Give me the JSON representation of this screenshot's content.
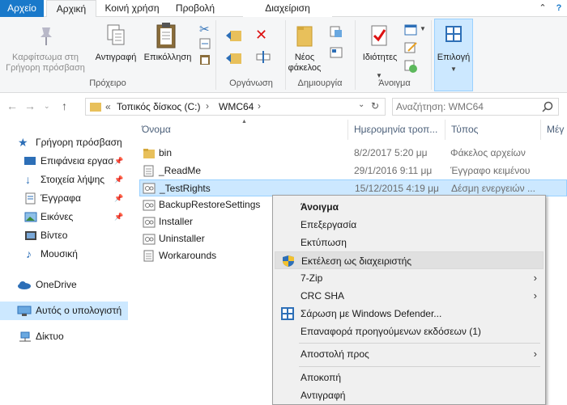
{
  "tabs": {
    "file": "Αρχείο",
    "home": "Αρχική",
    "share": "Κοινή χρήση",
    "view": "Προβολή",
    "manage": "Διαχείριση"
  },
  "ribbon": {
    "pin_quick_access": "Καρφίτσωμα στη Γρήγορη πρόσβαση",
    "copy": "Αντιγραφή",
    "paste": "Επικόλληση",
    "clipboard_group": "Πρόχειρο",
    "organize_group": "Οργάνωση",
    "new_folder": "Νέος φάκελος",
    "create_group": "Δημιουργία",
    "properties": "Ιδιότητες",
    "open_group": "Άνοιγμα",
    "select": "Επιλογή"
  },
  "address": {
    "prefix": "«",
    "crumb1": "Τοπικός δίσκος (C:)",
    "crumb2": "WMC64",
    "search_placeholder": "Αναζήτηση: WMC64"
  },
  "nav": {
    "quick_access": "Γρήγορη πρόσβαση",
    "desktop": "Επιφάνεια εργασ",
    "downloads": "Στοιχεία λήψης",
    "documents": "Έγγραφα",
    "pictures": "Εικόνες",
    "videos": "Βίντεο",
    "music": "Μουσική",
    "onedrive": "OneDrive",
    "this_pc": "Αυτός ο υπολογιστή",
    "network": "Δίκτυο"
  },
  "columns": {
    "name": "Όνομα",
    "date": "Ημερομηνία τροπ...",
    "type": "Τύπος",
    "size": "Μέγ"
  },
  "files": [
    {
      "name": "bin",
      "date": "8/2/2017 5:20 μμ",
      "type": "Φάκελος αρχείων",
      "icon": "folder-icon"
    },
    {
      "name": "_ReadMe",
      "date": "29/1/2016 9:11 μμ",
      "type": "Έγγραφο κειμένου",
      "icon": "text-file-icon"
    },
    {
      "name": "_TestRights",
      "date": "15/12/2015 4:19 μμ",
      "type": "Δέσμη ενεργειών ...",
      "icon": "batch-file-icon"
    },
    {
      "name": "BackupRestoreSettings",
      "date": "",
      "type": "",
      "icon": "batch-file-icon"
    },
    {
      "name": "Installer",
      "date": "",
      "type": "",
      "icon": "batch-file-icon"
    },
    {
      "name": "Uninstaller",
      "date": "",
      "type": "",
      "icon": "batch-file-icon"
    },
    {
      "name": "Workarounds",
      "date": "",
      "type": "",
      "icon": "text-file-icon"
    }
  ],
  "context_menu": {
    "open": "Άνοιγμα",
    "edit": "Επεξεργασία",
    "print": "Εκτύπωση",
    "run_as_admin": "Εκτέλεση ως διαχειριστής",
    "zip": "7-Zip",
    "crc": "CRC SHA",
    "defender": "Σάρωση με Windows Defender...",
    "restore": "Επαναφορά προηγούμενων εκδόσεων (1)",
    "send_to": "Αποστολή προς",
    "cut": "Αποκοπή",
    "copy": "Αντιγραφή"
  },
  "colors": {
    "accent": "#1979ca",
    "selection": "#cce8ff",
    "folder": "#e8c05b"
  }
}
